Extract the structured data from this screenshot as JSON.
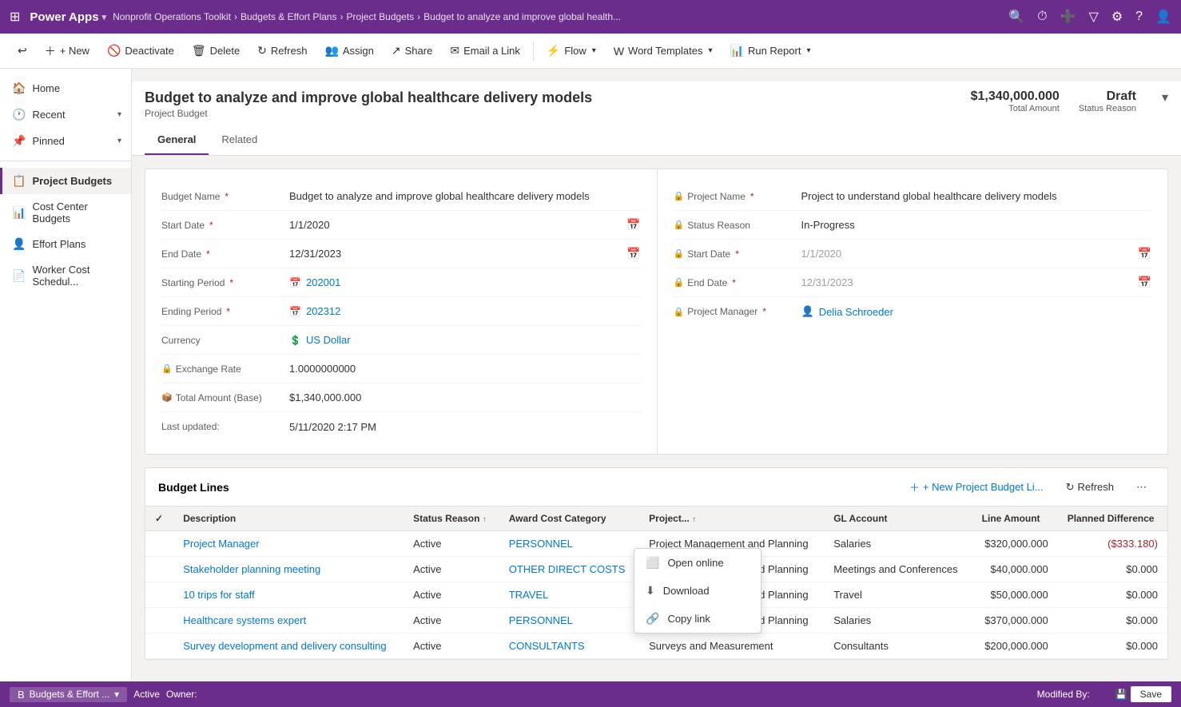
{
  "topNav": {
    "appName": "Power Apps",
    "breadcrumb": [
      "Nonprofit Operations Toolkit",
      "Budgets & Effort Plans",
      "Project Budgets",
      "Budget to analyze and improve global health..."
    ]
  },
  "toolbar": {
    "back_icon": "←",
    "new": "+ New",
    "deactivate": "Deactivate",
    "delete": "Delete",
    "refresh": "Refresh",
    "assign": "Assign",
    "share": "Share",
    "emailALink": "Email a Link",
    "flow": "Flow",
    "wordTemplates": "Word Templates",
    "runReport": "Run Report"
  },
  "sidebar": {
    "home": "Home",
    "recent": "Recent",
    "pinned": "Pinned",
    "nav_items": [
      {
        "id": "project-budgets",
        "label": "Project Budgets",
        "icon": "📋",
        "active": true
      },
      {
        "id": "cost-center-budgets",
        "label": "Cost Center Budgets",
        "icon": "📊"
      },
      {
        "id": "effort-plans",
        "label": "Effort Plans",
        "icon": "👤"
      },
      {
        "id": "worker-cost-schedule",
        "label": "Worker Cost Schedul...",
        "icon": "📄"
      }
    ]
  },
  "record": {
    "title": "Budget to analyze and improve global healthcare delivery models",
    "subtitle": "Project Budget",
    "totalAmount": "$1,340,000.000",
    "totalAmountLabel": "Total Amount",
    "statusReason": "Draft",
    "statusReasonLabel": "Status Reason"
  },
  "tabs": [
    {
      "id": "general",
      "label": "General",
      "active": true
    },
    {
      "id": "related",
      "label": "Related",
      "active": false
    }
  ],
  "form": {
    "left": {
      "budgetName": {
        "label": "Budget Name",
        "value": "Budget to analyze and improve global healthcare delivery models",
        "required": true
      },
      "startDate": {
        "label": "Start Date",
        "value": "1/1/2020",
        "required": true
      },
      "endDate": {
        "label": "End Date",
        "value": "12/31/2023",
        "required": true
      },
      "startingPeriod": {
        "label": "Starting Period",
        "value": "202001",
        "required": true
      },
      "endingPeriod": {
        "label": "Ending Period",
        "value": "202312",
        "required": true
      },
      "currency": {
        "label": "Currency",
        "value": "US Dollar"
      },
      "exchangeRate": {
        "label": "Exchange Rate",
        "value": "1.0000000000"
      },
      "totalAmountBase": {
        "label": "Total Amount (Base)",
        "value": "$1,340,000.000"
      },
      "lastUpdated": {
        "label": "Last updated:",
        "value": "5/11/2020 2:17 PM"
      }
    },
    "right": {
      "projectName": {
        "label": "Project Name",
        "value": "Project to understand global healthcare delivery models",
        "required": true
      },
      "statusReason": {
        "label": "Status Reason",
        "value": "In-Progress"
      },
      "startDate": {
        "label": "Start Date",
        "value": "1/1/2020",
        "required": true
      },
      "endDate": {
        "label": "End Date",
        "value": "12/31/2023",
        "required": true
      },
      "projectManager": {
        "label": "Project Manager",
        "value": "Delia Schroeder",
        "required": true
      }
    }
  },
  "budgetLines": {
    "title": "Budget Lines",
    "newButton": "+ New Project Budget Li...",
    "refreshButton": "Refresh",
    "columns": [
      "Description",
      "Status Reason",
      "Award Cost Category",
      "Project...",
      "GL Account",
      "Line Amount",
      "Planned Difference"
    ],
    "rows": [
      {
        "description": "Project Manager",
        "statusReason": "Active",
        "awardCostCategory": "PERSONNEL",
        "project": "Project Management and Planning",
        "glAccount": "Salaries",
        "lineAmount": "$320,000.000",
        "plannedDifference": "($333.180)"
      },
      {
        "description": "Stakeholder planning meeting",
        "statusReason": "Active",
        "awardCostCategory": "OTHER DIRECT COSTS",
        "project": "Project Management and Planning",
        "glAccount": "Meetings and Conferences",
        "lineAmount": "$40,000.000",
        "plannedDifference": "$0.000"
      },
      {
        "description": "10 trips for staff",
        "statusReason": "Active",
        "awardCostCategory": "TRAVEL",
        "project": "Project Management and Planning",
        "glAccount": "Travel",
        "lineAmount": "$50,000.000",
        "plannedDifference": "$0.000"
      },
      {
        "description": "Healthcare systems expert",
        "statusReason": "Active",
        "awardCostCategory": "PERSONNEL",
        "project": "Project Management and Planning",
        "glAccount": "Salaries",
        "lineAmount": "$370,000.000",
        "plannedDifference": "$0.000"
      },
      {
        "description": "Survey development and delivery consulting",
        "statusReason": "Active",
        "awardCostCategory": "CONSULTANTS",
        "project": "Surveys and Measurement",
        "glAccount": "Consultants",
        "lineAmount": "$200,000.000",
        "plannedDifference": "$0.000"
      }
    ]
  },
  "contextMenu": {
    "items": [
      {
        "id": "open-online",
        "icon": "⬜",
        "label": "Open online"
      },
      {
        "id": "download",
        "icon": "⬇",
        "label": "Download"
      },
      {
        "id": "copy-link",
        "icon": "🔗",
        "label": "Copy link"
      }
    ]
  },
  "statusBar": {
    "appLabel": "Budgets & Effort ...",
    "status": "Active",
    "ownerLabel": "Owner:",
    "modifiedByLabel": "Modified By:",
    "saveLabel": "Save"
  }
}
